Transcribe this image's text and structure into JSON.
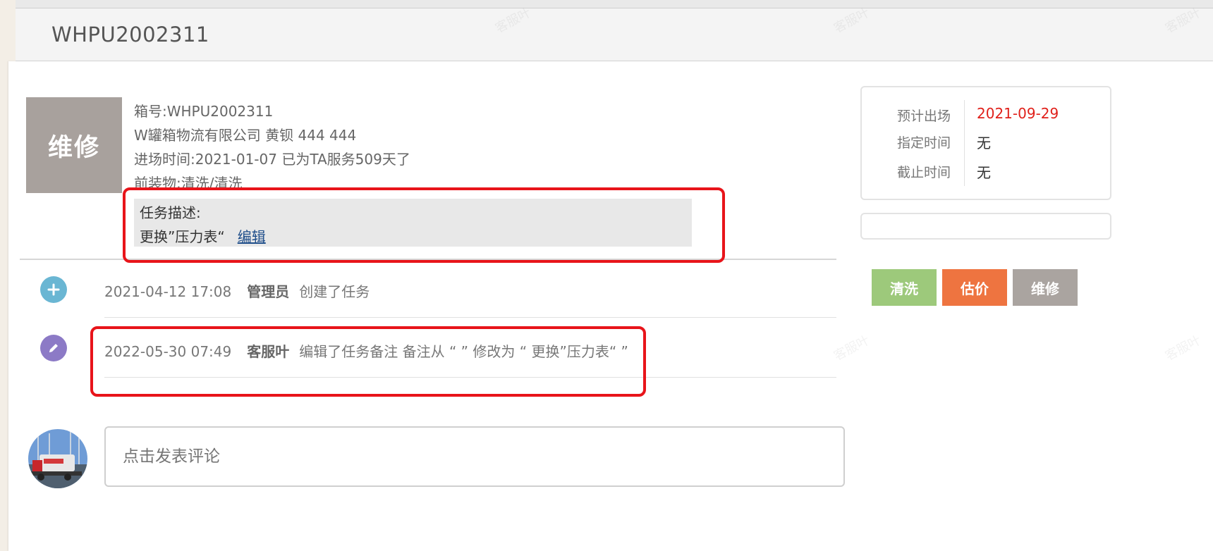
{
  "header": {
    "title": "WHPU2002311"
  },
  "container": {
    "status_tile": "维修",
    "box_no": "箱号:WHPU2002311",
    "company_line": "W罐箱物流有限公司 黄钡 444 444",
    "entry_line": "进场时间:2021-01-07 已为TA服务509天了",
    "previous_cargo": "前装物:清洗/清洗"
  },
  "task": {
    "label": "任务描述:",
    "text": "更换”压力表“",
    "edit_link": "编辑"
  },
  "events": [
    {
      "icon": "plus-icon",
      "time": "2021-04-12 17:08",
      "user": "管理员",
      "action": "创建了任务"
    },
    {
      "icon": "pencil-icon",
      "time": "2022-05-30 07:49",
      "user": "客服叶",
      "action": "编辑了任务备注 备注从 “ ” 修改为 “ 更换”压力表“ ”"
    }
  ],
  "comment": {
    "placeholder": "点击发表评论"
  },
  "schedule": {
    "expected_exit_label": "预计出场",
    "expected_exit_value": "2021-09-29",
    "assigned_time_label": "指定时间",
    "assigned_time_value": "无",
    "deadline_label": "截止时间",
    "deadline_value": "无"
  },
  "actions": {
    "clean": "清洗",
    "estimate": "估价",
    "repair": "维修"
  },
  "colors": {
    "status_tile": "#a8a19d",
    "clean": "#9dc97b",
    "estimate": "#ee7440",
    "repair": "#aaa4a0",
    "highlight": "#e8141a",
    "date_red": "#e0201a"
  }
}
